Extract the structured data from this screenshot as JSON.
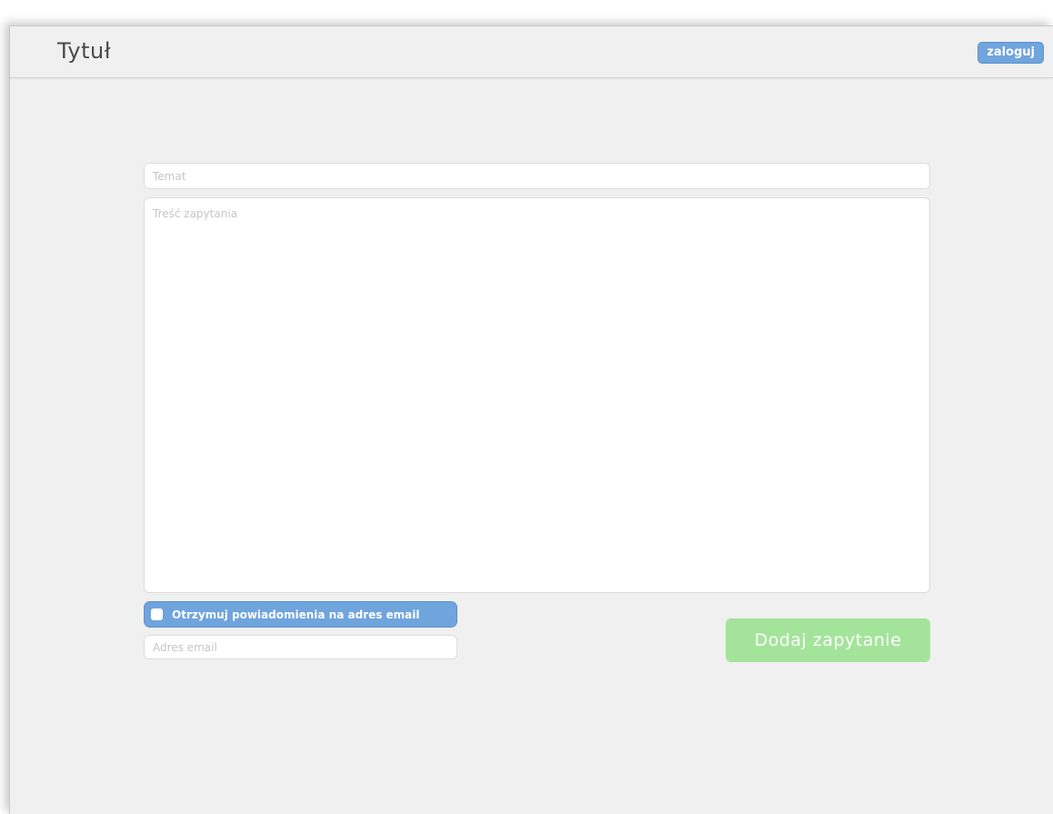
{
  "header": {
    "title": "Tytuł",
    "login_label": "zaloguj"
  },
  "form": {
    "subject": {
      "value": "",
      "placeholder": "Temat"
    },
    "content": {
      "value": "",
      "placeholder": "Treść zapytania"
    },
    "notify": {
      "label": "Otrzymuj powiadomienia na adres email",
      "checked": false
    },
    "email": {
      "value": "",
      "placeholder": "Adres email"
    },
    "submit_label": "Dodaj zapytanie"
  },
  "colors": {
    "accent_blue": "#6fa4dd",
    "submit_green": "#a3e49a",
    "background": "#f0f0f0"
  }
}
